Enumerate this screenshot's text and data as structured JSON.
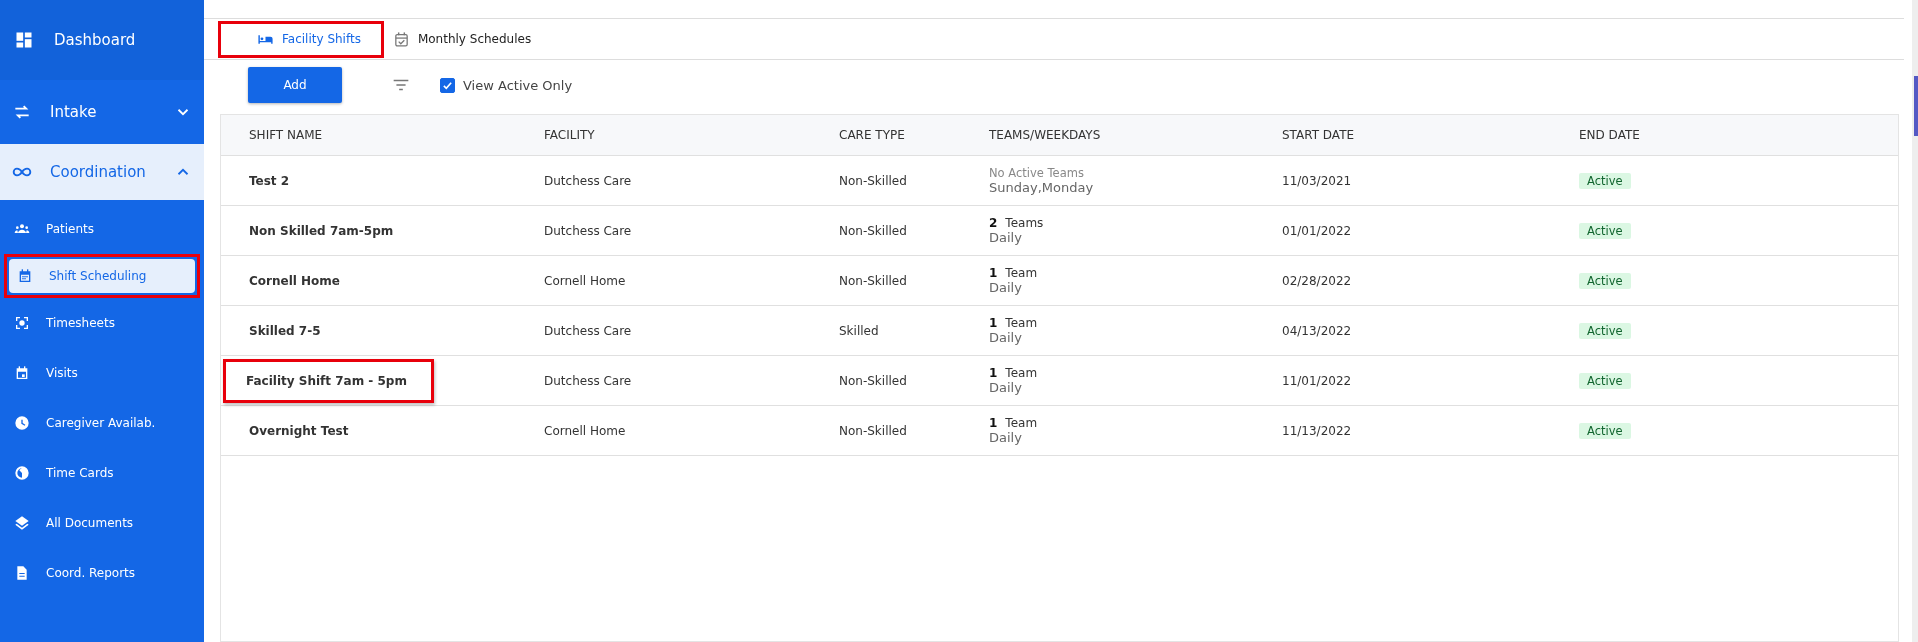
{
  "sidebar": {
    "items": [
      {
        "kind": "top",
        "label": "Dashboard",
        "selected": false,
        "outlined": false
      },
      {
        "kind": "section",
        "label": "Intake",
        "expanded": false,
        "outlined": false
      },
      {
        "kind": "section",
        "label": "Coordination",
        "expanded": true,
        "outlined": false
      },
      {
        "kind": "item",
        "label": "Patients",
        "selected": false,
        "outlined": false
      },
      {
        "kind": "item",
        "label": "Shift Scheduling",
        "selected": true,
        "outlined": true
      },
      {
        "kind": "item",
        "label": "Timesheets",
        "selected": false,
        "outlined": false
      },
      {
        "kind": "item",
        "label": "Visits",
        "selected": false,
        "outlined": false
      },
      {
        "kind": "item",
        "label": "Caregiver Availab.",
        "selected": false,
        "outlined": false
      },
      {
        "kind": "item",
        "label": "Time Cards",
        "selected": false,
        "outlined": false
      },
      {
        "kind": "item",
        "label": "All Documents",
        "selected": false,
        "outlined": false
      },
      {
        "kind": "item",
        "label": "Coord. Reports",
        "selected": false,
        "outlined": false
      }
    ]
  },
  "tabs": [
    {
      "label": "Facility Shifts",
      "selected": true,
      "outlined": true
    },
    {
      "label": "Monthly Schedules",
      "selected": false,
      "outlined": false
    }
  ],
  "toolbar": {
    "add_button": "Add",
    "view_active_only": {
      "label": "View Active Only",
      "checked": true
    }
  },
  "table": {
    "columns": [
      "SHIFT NAME",
      "FACILITY",
      "CARE TYPE",
      "TEAMS/WEEKDAYS",
      "START DATE",
      "END DATE"
    ],
    "rows": [
      {
        "shift_name": "Test 2",
        "outlined": false,
        "facility": "Dutchess Care",
        "care_type": "Non-Skilled",
        "teams_count": "",
        "teams_label": "No Active Teams",
        "weekdays": "Sunday,Monday",
        "start_date": "11/03/2021",
        "status": "Active"
      },
      {
        "shift_name": "Non Skilled 7am-5pm",
        "outlined": false,
        "facility": "Dutchess Care",
        "care_type": "Non-Skilled",
        "teams_count": "2",
        "teams_label": "Teams",
        "weekdays": "Daily",
        "start_date": "01/01/2022",
        "status": "Active"
      },
      {
        "shift_name": "Cornell Home",
        "outlined": false,
        "facility": "Cornell Home",
        "care_type": "Non-Skilled",
        "teams_count": "1",
        "teams_label": "Team",
        "weekdays": "Daily",
        "start_date": "02/28/2022",
        "status": "Active"
      },
      {
        "shift_name": "Skilled 7-5",
        "outlined": false,
        "facility": "Dutchess Care",
        "care_type": "Skilled",
        "teams_count": "1",
        "teams_label": "Team",
        "weekdays": "Daily",
        "start_date": "04/13/2022",
        "status": "Active"
      },
      {
        "shift_name": "Facility Shift 7am - 5pm",
        "outlined": true,
        "facility": "Dutchess Care",
        "care_type": "Non-Skilled",
        "teams_count": "1",
        "teams_label": "Team",
        "weekdays": "Daily",
        "start_date": "11/01/2022",
        "status": "Active"
      },
      {
        "shift_name": "Overnight Test",
        "outlined": false,
        "facility": "Cornell Home",
        "care_type": "Non-Skilled",
        "teams_count": "1",
        "teams_label": "Team",
        "weekdays": "Daily",
        "start_date": "11/13/2022",
        "status": "Active"
      }
    ]
  }
}
